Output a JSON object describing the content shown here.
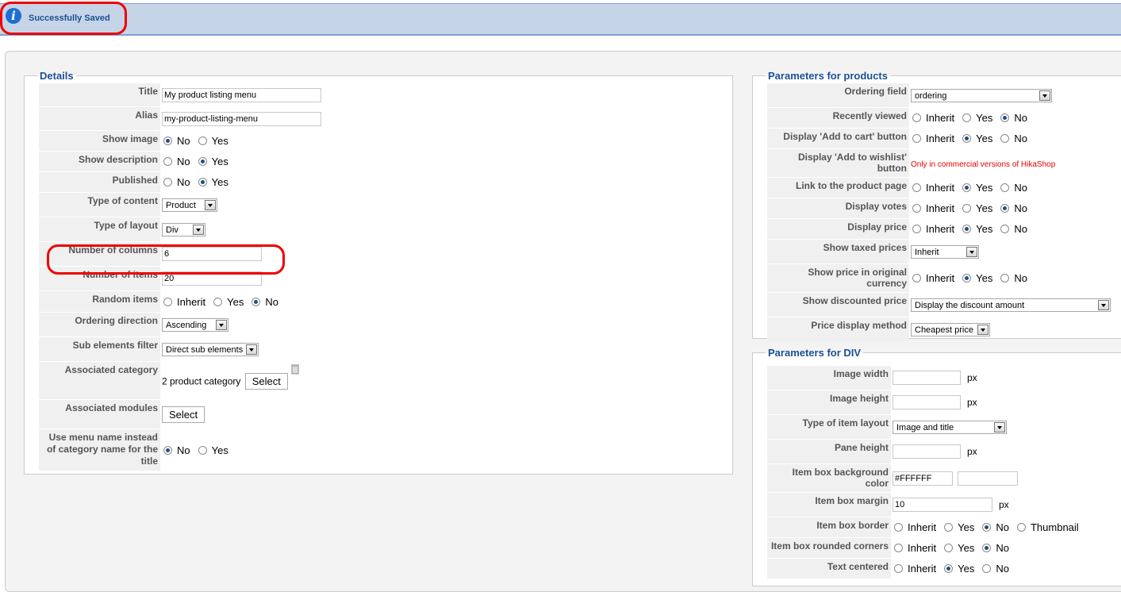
{
  "message": {
    "text": "Successfully Saved",
    "icon": "info-icon"
  },
  "details": {
    "legend": "Details",
    "title_label": "Title",
    "title_value": "My product listing menu",
    "alias_label": "Alias",
    "alias_value": "my-product-listing-menu",
    "show_image_label": "Show image",
    "show_description_label": "Show description",
    "published_label": "Published",
    "type_content_label": "Type of content",
    "type_content_value": "Product",
    "type_layout_label": "Type of layout",
    "type_layout_value": "Div",
    "num_columns_label": "Number of columns",
    "num_columns_value": "6",
    "num_items_label": "Number of items",
    "num_items_value": "20",
    "random_items_label": "Random items",
    "ordering_direction_label": "Ordering direction",
    "ordering_direction_value": "Ascending",
    "sub_filter_label": "Sub elements filter",
    "sub_filter_value": "Direct sub elements",
    "assoc_category_label": "Associated category",
    "assoc_category_value": "2 product category",
    "assoc_modules_label": "Associated modules",
    "use_menu_name_label": "Use menu name instead of category name for the title"
  },
  "options": {
    "no": "No",
    "yes": "Yes",
    "inherit": "Inherit",
    "thumbnail": "Thumbnail",
    "select": "Select",
    "px": "px"
  },
  "products": {
    "legend": "Parameters for products",
    "ordering_field_label": "Ordering field",
    "ordering_field_value": "ordering",
    "recently_viewed_label": "Recently viewed",
    "add_to_cart_label": "Display 'Add to cart' button",
    "add_to_wishlist_label": "Display 'Add to wishlist' button",
    "add_to_wishlist_note": "Only in commercial versions of HikaShop",
    "link_product_label": "Link to the product page",
    "display_votes_label": "Display votes",
    "display_price_label": "Display price",
    "show_taxed_label": "Show taxed prices",
    "show_taxed_value": "Inherit",
    "original_currency_label": "Show price in original currency",
    "discounted_label": "Show discounted price",
    "discounted_value": "Display the discount amount",
    "price_method_label": "Price display method",
    "price_method_value": "Cheapest price"
  },
  "div": {
    "legend": "Parameters for DIV",
    "image_width_label": "Image width",
    "image_height_label": "Image height",
    "item_layout_label": "Type of item layout",
    "item_layout_value": "Image and title",
    "pane_height_label": "Pane height",
    "bg_color_label": "Item box background color",
    "bg_color_value": "#FFFFFF",
    "margin_label": "Item box margin",
    "margin_value": "10",
    "border_label": "Item box border",
    "rounded_label": "Item box rounded corners",
    "centered_label": "Text centered"
  }
}
